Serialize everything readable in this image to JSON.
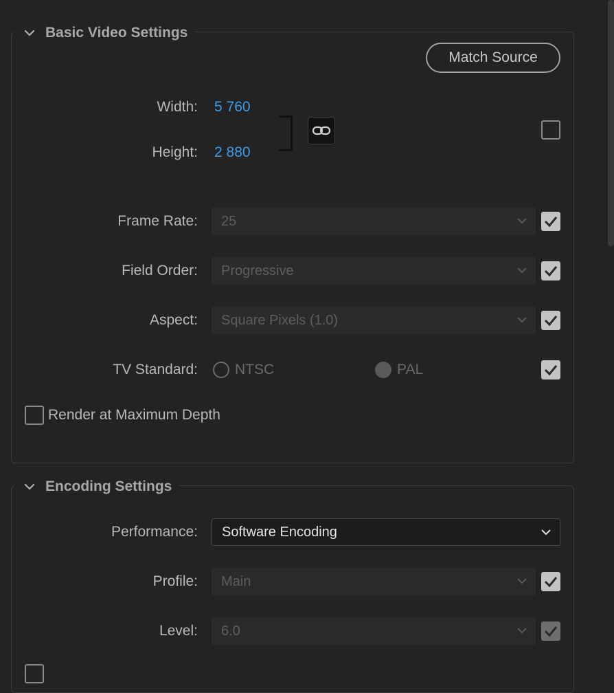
{
  "basic_video": {
    "title": "Basic Video Settings",
    "match_source": "Match Source",
    "width_label": "Width:",
    "width_value": "5 760",
    "height_label": "Height:",
    "height_value": "2 880",
    "frame_rate_label": "Frame Rate:",
    "frame_rate_value": "25",
    "field_order_label": "Field Order:",
    "field_order_value": "Progressive",
    "aspect_label": "Aspect:",
    "aspect_value": "Square Pixels (1.0)",
    "tv_standard_label": "TV Standard:",
    "tv_ntsc": "NTSC",
    "tv_pal": "PAL",
    "render_max_depth": "Render at Maximum Depth"
  },
  "encoding": {
    "title": "Encoding Settings",
    "performance_label": "Performance:",
    "performance_value": "Software Encoding",
    "profile_label": "Profile:",
    "profile_value": "Main",
    "level_label": "Level:",
    "level_value": "6.0"
  },
  "colors": {
    "accent_value": "#3c9be6",
    "background": "#232323"
  },
  "icons": [
    "chevron-down-icon",
    "link-icon",
    "checkmark-icon"
  ]
}
